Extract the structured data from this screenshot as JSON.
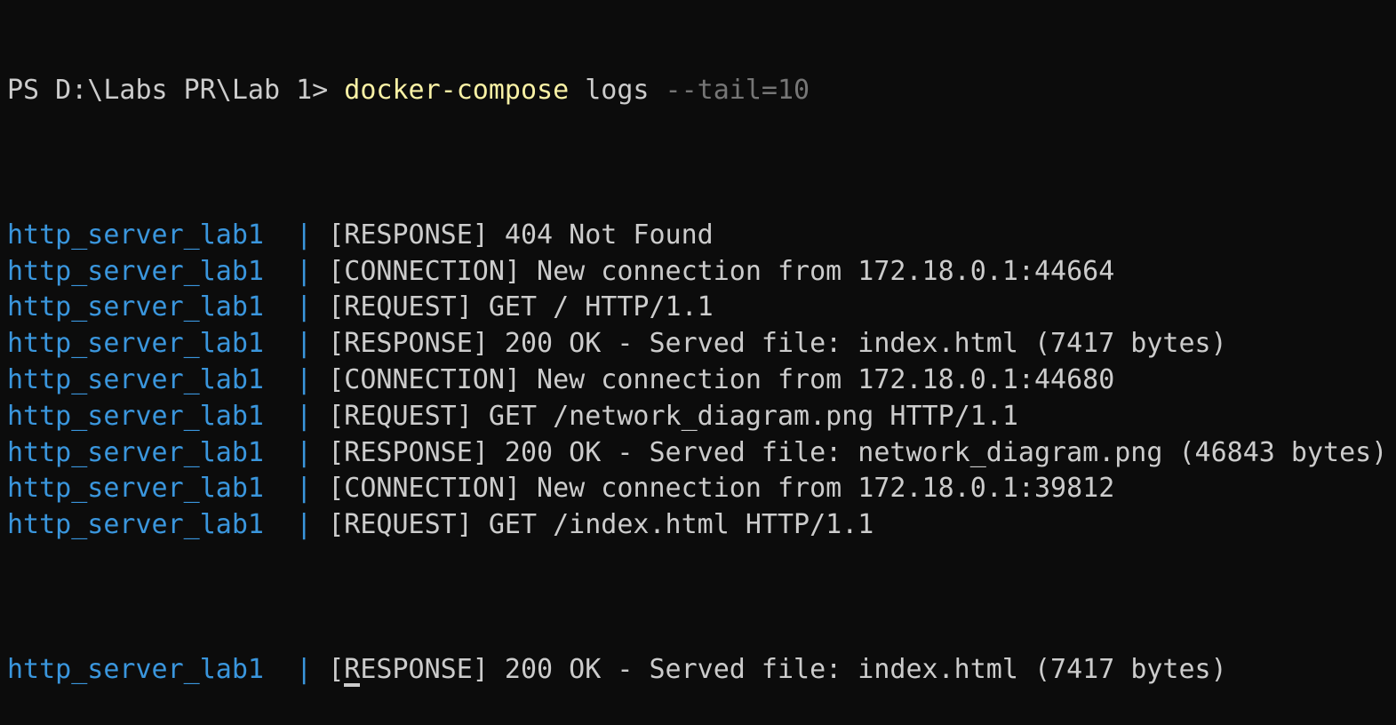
{
  "prompt": {
    "ps_prefix": "PS D:\\Labs PR\\Lab 1> ",
    "command": "docker-compose",
    "args": " logs ",
    "flag": "--tail=10"
  },
  "log_lines": [
    {
      "service": "http_server_lab1",
      "sep": "  | ",
      "message": "[RESPONSE] 404 Not Found"
    },
    {
      "service": "http_server_lab1",
      "sep": "  | ",
      "message": "[CONNECTION] New connection from 172.18.0.1:44664"
    },
    {
      "service": "http_server_lab1",
      "sep": "  | ",
      "message": "[REQUEST] GET / HTTP/1.1"
    },
    {
      "service": "http_server_lab1",
      "sep": "  | ",
      "message": "[RESPONSE] 200 OK - Served file: index.html (7417 bytes)"
    },
    {
      "service": "http_server_lab1",
      "sep": "  | ",
      "message": "[CONNECTION] New connection from 172.18.0.1:44680"
    },
    {
      "service": "http_server_lab1",
      "sep": "  | ",
      "message": "[REQUEST] GET /network_diagram.png HTTP/1.1"
    },
    {
      "service": "http_server_lab1",
      "sep": "  | ",
      "message": "[RESPONSE] 200 OK - Served file: network_diagram.png (46843 bytes)"
    },
    {
      "service": "http_server_lab1",
      "sep": "  | ",
      "message": "[CONNECTION] New connection from 172.18.0.1:39812"
    },
    {
      "service": "http_server_lab1",
      "sep": "  | ",
      "message": "[REQUEST] GET /index.html HTTP/1.1"
    }
  ],
  "last_line": {
    "service": "http_server_lab1",
    "sep": "  | ",
    "message_head": "[",
    "message_cursor_char": "R",
    "message_tail": "ESPONSE] 200 OK - Served file: index.html (7417 bytes)"
  },
  "colors": {
    "background": "#0c0c0c",
    "text": "#cccccc",
    "command": "#f9f1a5",
    "flag": "#767676",
    "service": "#3a96dd"
  }
}
